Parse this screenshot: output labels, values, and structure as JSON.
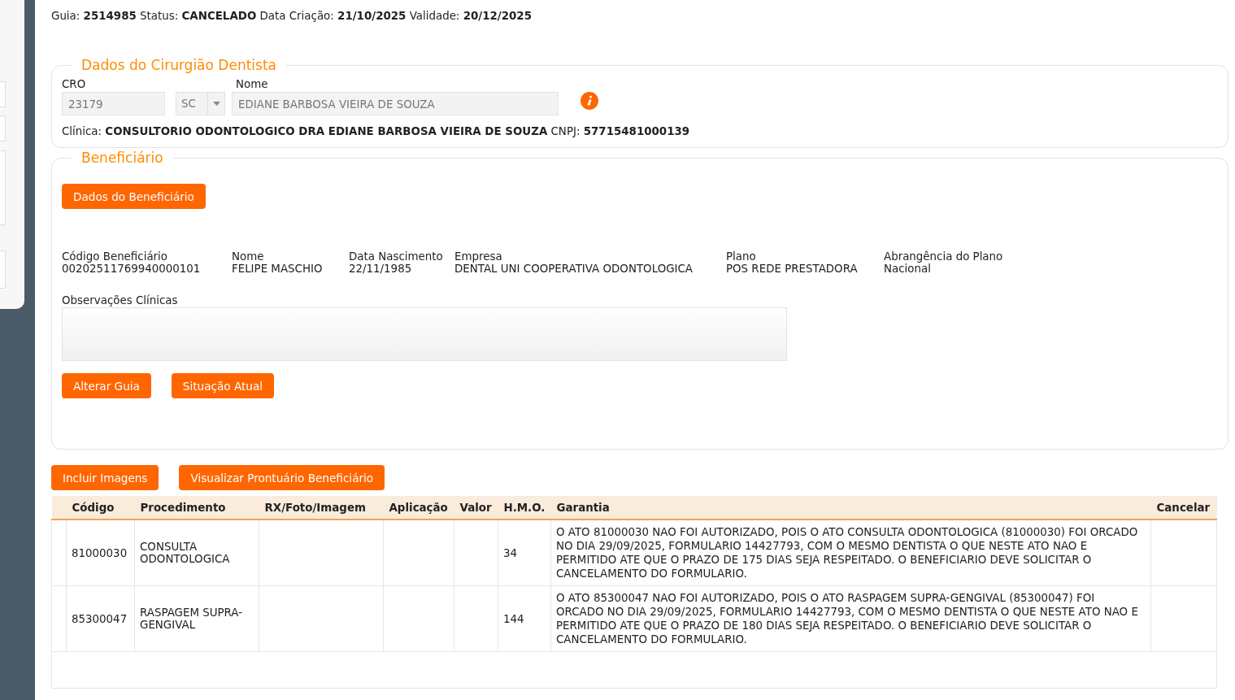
{
  "header": "Guia: **2514985** Status: **CANCELADO** Data Criação: **21/10/2025** Validade: **20/12/2025**",
  "dentist": {
    "legend": "Dados do Cirurgião Dentista",
    "cro_label": "CRO",
    "cro_value": "23179",
    "uf_value": "SC",
    "name_label": "Nome",
    "name_value": "EDIANE BARBOSA VIEIRA DE SOUZA",
    "clinic": "Clínica: **CONSULTORIO ODONTOLOGICO DRA EDIANE BARBOSA VIEIRA DE SOUZA** CNPJ: **57715481000139**"
  },
  "beneficiary": {
    "legend": "Beneficiário",
    "data_button": "Dados do Beneficiário",
    "fields": [
      {
        "label": "Código Beneficiário",
        "value": "00202511769940000101"
      },
      {
        "label": "Nome",
        "value": "FELIPE MASCHIO"
      },
      {
        "label": "Data Nascimento",
        "value": "22/11/1985"
      },
      {
        "label": "Empresa",
        "value": "DENTAL UNI COOPERATIVA ODONTOLOGICA"
      },
      {
        "label": "Plano",
        "value": "POS REDE PRESTADORA"
      },
      {
        "label": "Abrangência do Plano",
        "value": "Nacional"
      }
    ],
    "notes_label": "Observações Clínicas",
    "buttons": [
      "Alterar Guia",
      "Situação Atual"
    ]
  },
  "actions": [
    "Incluir Imagens",
    "Visualizar Prontuário Beneficiário"
  ],
  "table": {
    "columns": [
      "Código",
      "Procedimento",
      "RX/Foto/Imagem",
      "Aplicação",
      "Valor",
      "H.M.O.",
      "Garantia",
      "Cancelar"
    ],
    "rows": [
      {
        "codigo": "81000030",
        "procedimento": "CONSULTA ODONTOLOGICA",
        "hmo": "34",
        "garantia": "O ATO 81000030 NAO FOI AUTORIZADO, POIS O ATO CONSULTA ODONTOLOGICA (81000030) FOI ORCADO NO DIA 29/09/2025, FORMULARIO 14427793, COM O MESMO DENTISTA O QUE NESTE ATO NAO E PERMITIDO ATE QUE O PRAZO DE 175 DIAS SEJA RESPEITADO. O BENEFICIARIO DEVE SOLICITAR O CANCELAMENTO DO FORMULARIO."
      },
      {
        "codigo": "85300047",
        "procedimento": "RASPAGEM SUPRA-GENGIVAL",
        "hmo": "144",
        "garantia": "O ATO 85300047 NAO FOI AUTORIZADO, POIS O ATO RASPAGEM SUPRA-GENGIVAL (85300047) FOI ORCADO NO DIA 29/09/2025, FORMULARIO 14427793, COM O MESMO DENTISTA O QUE NESTE ATO NAO E PERMITIDO ATE QUE O PRAZO DE 180 DIAS SEJA RESPEITADO. O BENEFICIARIO DEVE SOLICITAR O CANCELAMENTO DO FORMULARIO."
      }
    ]
  }
}
